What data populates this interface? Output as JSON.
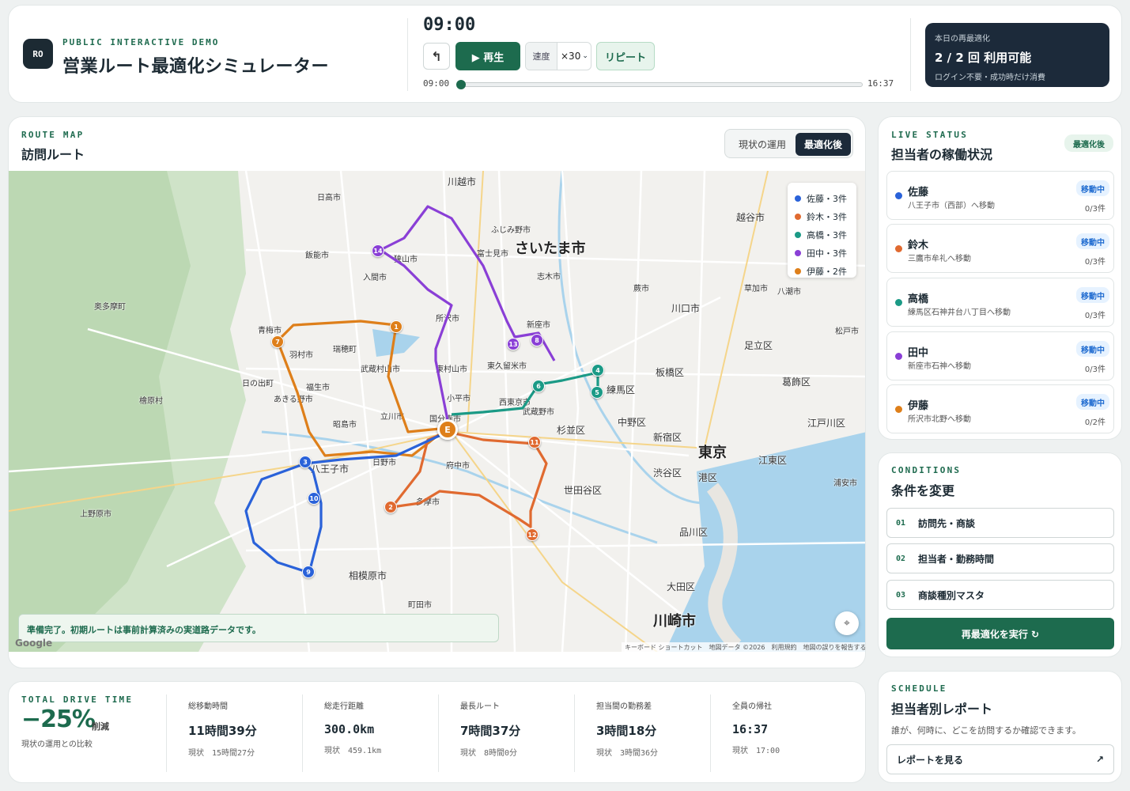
{
  "header": {
    "logo": "RO",
    "eyebrow": "PUBLIC INTERACTIVE DEMO",
    "title": "営業ルート最適化シミュレーター",
    "clock": "09:00",
    "back_icon": "↰",
    "play_label": "▶ 再生",
    "speed_label": "速度",
    "speed_value": "×30",
    "repeat_label": "リピート",
    "time_start": "09:00",
    "time_end": "16:37",
    "progress": 0
  },
  "reopt": {
    "label": "本日の再最適化",
    "count": "2 / 2 回 利用可能",
    "note": "ログイン不要・成功時だけ消費"
  },
  "map_card": {
    "eyebrow": "ROUTE MAP",
    "title": "訪問ルート",
    "tab_current": "現状の運用",
    "tab_optimized": "最適化後",
    "status_message": "準備完了。初期ルートは事前計算済みの実道路データです。",
    "attribution": "キーボード ショートカット　地図データ ©2026　利用規約　地図の誤りを報告する",
    "google": "Google",
    "depot": "E",
    "legend": [
      {
        "label": "佐藤・3件",
        "color": "#2a62d9"
      },
      {
        "label": "鈴木・3件",
        "color": "#e06a30"
      },
      {
        "label": "高橋・3件",
        "color": "#1b9a86"
      },
      {
        "label": "田中・3件",
        "color": "#8a3fd6"
      },
      {
        "label": "伊藤・2件",
        "color": "#de7f1a"
      }
    ],
    "place_labels": [
      "川越市",
      "日高市",
      "ふじみ野市",
      "越谷市",
      "さいたま市",
      "狭山市",
      "富士見市",
      "飯能市",
      "入間市",
      "志木市",
      "蕨市",
      "草加市",
      "八潮市",
      "川口市",
      "所沢市",
      "新座市",
      "青梅市",
      "奥多摩町",
      "瑞穂町",
      "羽村市",
      "武蔵村山市",
      "東村山市",
      "東久留米市",
      "足立区",
      "松戸市",
      "板橋区",
      "葛飾区",
      "日の出町",
      "福生市",
      "あきる野市",
      "檜原村",
      "小平市",
      "西東京市",
      "武蔵野市",
      "練馬区",
      "立川市",
      "昭島市",
      "国分寺市",
      "中野区",
      "杉並区",
      "新宿区",
      "江戸川区",
      "八王子市",
      "日野市",
      "府中市",
      "東京",
      "江東区",
      "上野原市",
      "多摩市",
      "渋谷区",
      "港区",
      "世田谷区",
      "浦安市",
      "品川区",
      "相模原市",
      "町田市",
      "大田区",
      "川崎市"
    ]
  },
  "status": {
    "eyebrow": "LIVE STATUS",
    "title": "担当者の稼働状況",
    "badge": "最適化後",
    "agents": [
      {
        "name": "佐藤",
        "desc": "八王子市（西部）へ移動",
        "state": "移動中",
        "count": "0/3件",
        "color": "#2a62d9"
      },
      {
        "name": "鈴木",
        "desc": "三鷹市牟礼へ移動",
        "state": "移動中",
        "count": "0/3件",
        "color": "#e06a30"
      },
      {
        "name": "高橋",
        "desc": "練馬区石神井台八丁目へ移動",
        "state": "移動中",
        "count": "0/3件",
        "color": "#1b9a86"
      },
      {
        "name": "田中",
        "desc": "新座市石神へ移動",
        "state": "移動中",
        "count": "0/3件",
        "color": "#8a3fd6"
      },
      {
        "name": "伊藤",
        "desc": "所沢市北野へ移動",
        "state": "移動中",
        "count": "0/2件",
        "color": "#de7f1a"
      }
    ]
  },
  "conditions": {
    "eyebrow": "CONDITIONS",
    "title": "条件を変更",
    "options": [
      {
        "num": "01",
        "label": "訪問先・商談"
      },
      {
        "num": "02",
        "label": "担当者・勤務時間"
      },
      {
        "num": "03",
        "label": "商談種別マスタ"
      }
    ],
    "run_label": "再最適化を実行 ↻"
  },
  "report": {
    "eyebrow": "SCHEDULE",
    "title": "担当者別レポート",
    "desc": "誰が、何時に、どこを訪問するか確認できます。",
    "button": "レポートを見る",
    "button_icon": "↗"
  },
  "summary": {
    "eyebrow": "TOTAL DRIVE TIME",
    "percent": "−25%",
    "cut_label": "削減",
    "compare": "現状の運用との比較",
    "metrics": [
      {
        "label": "総移動時間",
        "value": "11時間39分",
        "sub": "現状　15時間27分"
      },
      {
        "label": "総走行距離",
        "value": "300.0km",
        "sub": "現状　459.1km"
      },
      {
        "label": "最長ルート",
        "value": "7時間37分",
        "sub": "現状　8時間0分"
      },
      {
        "label": "担当間の勤務差",
        "value": "3時間18分",
        "sub": "現状　3時間36分"
      },
      {
        "label": "全員の帰社",
        "value": "16:37",
        "sub": "現状　17:00"
      }
    ]
  }
}
